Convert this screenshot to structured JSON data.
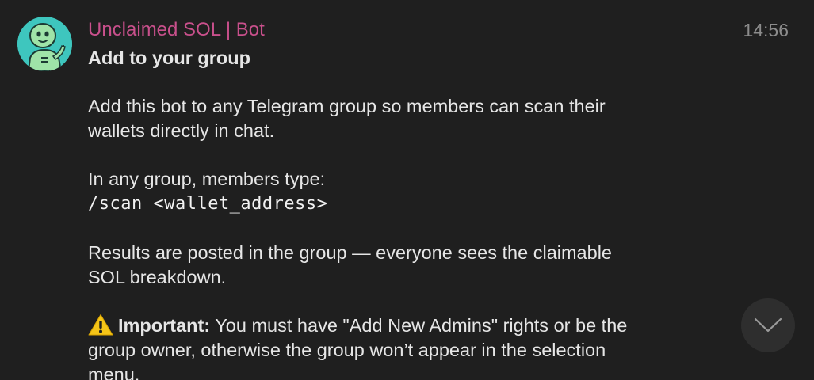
{
  "message": {
    "sender": "Unclaimed SOL | Bot",
    "time": "14:56",
    "avatar_icon": "robot-mascot-icon",
    "heading": "Add to your group",
    "para1_line1": "Add this bot to any Telegram group so members can scan their",
    "para1_line2": "wallets directly in chat.",
    "para2_line1": "In any group, members type:",
    "para2_command": "/scan <wallet_address>",
    "para3_line1": "Results are posted in the group — everyone sees the claimable",
    "para3_line2": "SOL breakdown.",
    "warning_icon": "warning-icon",
    "para4_bold": "Important:",
    "para4_line1_rest": " You must have \"Add New Admins\" rights or be the",
    "para4_line2": "group owner, otherwise the group won’t appear in the selection",
    "para4_line3": "menu."
  },
  "scroll_button": {
    "icon": "chevron-down-icon"
  },
  "colors": {
    "background": "#1f1f1f",
    "sender_name": "#c9508c",
    "text": "#e6e6e6",
    "timestamp": "#8c8c8c",
    "avatar_bg": "#40c8c0"
  }
}
